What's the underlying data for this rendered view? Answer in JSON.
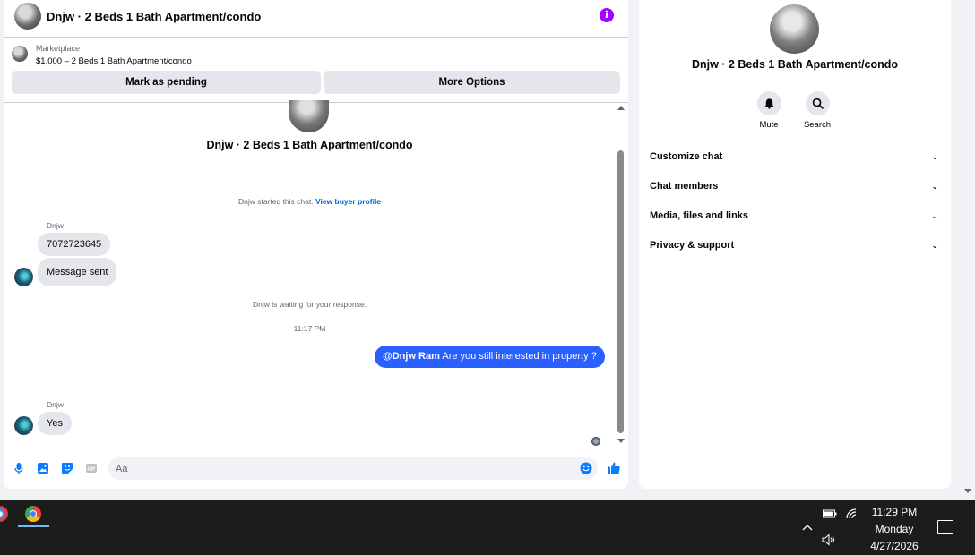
{
  "chat": {
    "title": "Dnjw · 2 Beds 1 Bath Apartment/condo",
    "marketplace_label": "Marketplace",
    "listing": "$1,000 – 2 Beds 1 Bath Apartment/condo",
    "mark_pending_label": "Mark as pending",
    "more_options_label": "More Options",
    "thread_title": "Dnjw · 2 Beds 1 Bath Apartment/condo",
    "started_text": "Dnjw started this chat.",
    "view_profile_label": "View buyer profile",
    "messages": [
      {
        "sender": "Dnjw",
        "text": "7072723645"
      },
      {
        "text": "Message sent"
      }
    ],
    "waiting_text": "Dnjw is waiting for your response.",
    "timestamp": "11:17 PM",
    "outgoing_mention": "@Dnjw Ram",
    "outgoing_text": "Are you still interested in property ?",
    "reply_sender": "Dnjw",
    "reply_text": "Yes",
    "composer_placeholder": "Aa"
  },
  "side": {
    "title": "Dnjw · 2 Beds 1 Bath Apartment/condo",
    "mute_label": "Mute",
    "search_label": "Search",
    "menu": [
      {
        "label": "Customize chat"
      },
      {
        "label": "Chat members"
      },
      {
        "label": "Media, files and links"
      },
      {
        "label": "Privacy & support"
      }
    ]
  },
  "taskbar": {
    "time": "11:29 PM",
    "day": "Monday",
    "date": "4/27/2026"
  },
  "colors": {
    "accent": "#2a60ff",
    "info": "#a200ff",
    "icon_blue": "#0a7cff",
    "link": "#0064d1"
  },
  "icons": {
    "info": "info-icon",
    "mic": "microphone-icon",
    "photo": "photo-icon",
    "sticker": "sticker-icon",
    "gif": "gif-icon",
    "emoji": "emoji-icon",
    "like": "thumbs-up-icon",
    "mute": "bell-icon",
    "search": "search-icon"
  }
}
